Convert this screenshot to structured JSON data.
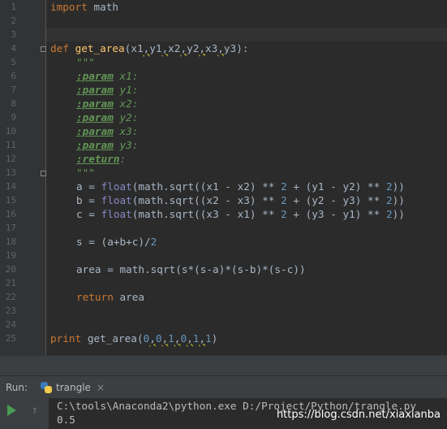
{
  "gutter": {
    "numbers": [
      "1",
      "2",
      "3",
      "4",
      "5",
      "6",
      "7",
      "8",
      "9",
      "10",
      "11",
      "12",
      "13",
      "14",
      "15",
      "16",
      "17",
      "18",
      "19",
      "20",
      "21",
      "22",
      "23",
      "24",
      "25"
    ]
  },
  "code": {
    "l1_kw": "import",
    "l1_rest": " math",
    "l4_kw": "def",
    "l4_fn": "get_area",
    "l4_open": "(",
    "l4_x1": "x1",
    "l4_y1": "y1",
    "l4_x2": "x2",
    "l4_y2": "y2",
    "l4_x3": "x3",
    "l4_y3": "y3",
    "l4_close": "):",
    "comma": ",",
    "doc_quotes": "\"\"\"",
    "param_tag": ":param",
    "return_tag": ":return",
    "p_x1": " x1:",
    "p_y1": " y1:",
    "p_x2": " x2:",
    "p_y2": " y2:",
    "p_x3": " x3:",
    "p_y3": " y3:",
    "ret_colon": ":",
    "float": "float",
    "l14_a": "a = ",
    "l14_b": "(math.sqrt((x1 - x2) ** ",
    "l14_c": " + (y1 - y2) ** ",
    "l14_d": "))",
    "l15_a": "b = ",
    "l15_b": "(math.sqrt((x2 - x3) ** ",
    "l15_c": " + (y2 - y3) ** ",
    "l15_d": "))",
    "l16_a": "c = ",
    "l16_b": "(math.sqrt((x3 - x1) ** ",
    "l16_c": " + (y3 - y1) ** ",
    "l16_d": "))",
    "two": "2",
    "l18": "s = (a+b+c)/",
    "l20": "area = math.sqrt(s*(s-a)*(s-b)*(s-c))",
    "l22_kw": "return",
    "l22_rest": " area",
    "l25_kw": "print",
    "l25_fn": " get_area(",
    "l25_end": ")",
    "zero": "0",
    "one": "1"
  },
  "run": {
    "label": "Run:",
    "tab_name": "trangle",
    "close": "×"
  },
  "console": {
    "cmd": "C:\\tools\\Anaconda2\\python.exe D:/Project/Python/trangle.py",
    "result": "0.5",
    "watermark": "https://blog.csdn.net/xiaxianba"
  },
  "colors": {
    "background": "#2b2b2b",
    "keyword": "#cc7832",
    "function": "#ffc66d",
    "number": "#6897bb",
    "docstring": "#629755",
    "builtin": "#8888c6"
  }
}
